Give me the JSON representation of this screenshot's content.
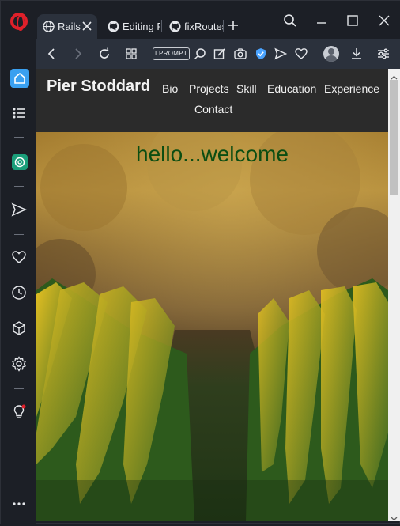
{
  "tabs": [
    {
      "label": "Rails",
      "icon": "globe-icon",
      "active": true
    },
    {
      "label": "Editing R",
      "icon": "github-icon"
    },
    {
      "label": "fixRoutes",
      "icon": "github-icon"
    }
  ],
  "toolbar": {
    "prompt_label": "I PROMPT"
  },
  "site": {
    "brand": "Pier Stoddard",
    "nav": [
      "Bio",
      "Projects",
      "Skill",
      "Education",
      "Experience",
      "Contact"
    ],
    "hero_title": "hello...welcome"
  },
  "colors": {
    "accent_blue": "#3aa0f0",
    "opera_red": "#e0202a",
    "hero_title": "#0b4d12"
  }
}
